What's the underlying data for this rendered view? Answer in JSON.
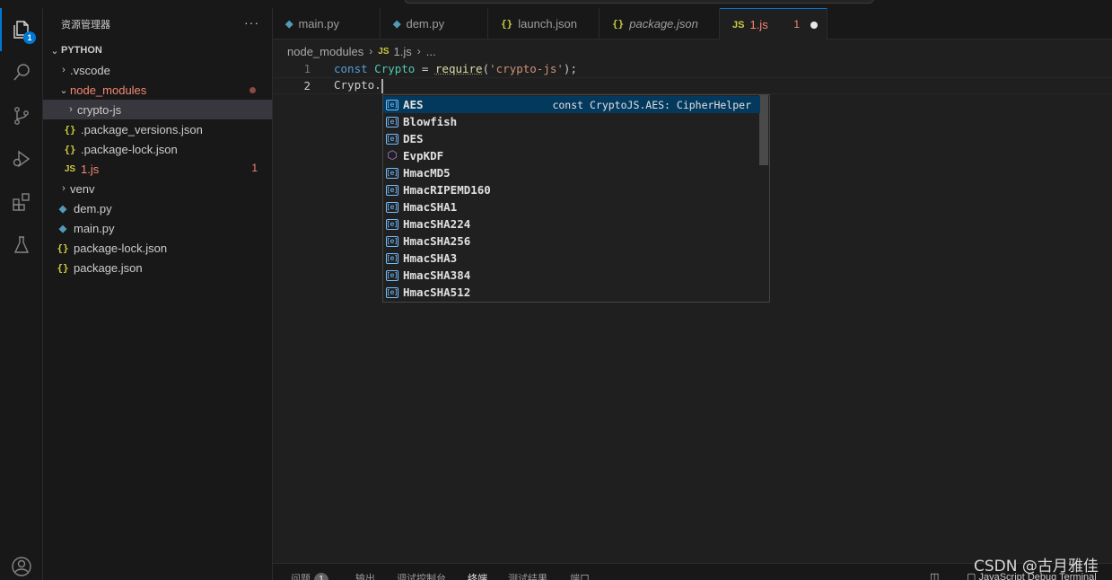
{
  "sidebar": {
    "title": "资源管理器",
    "more": "···",
    "explorer_badge": "1",
    "root": "PYTHON",
    "items": [
      {
        "label": ".vscode",
        "kind": "folder",
        "expanded": false
      },
      {
        "label": "node_modules",
        "kind": "folder",
        "expanded": true,
        "modified": true
      },
      {
        "label": "crypto-js",
        "kind": "folder",
        "expanded": false,
        "selected": true
      },
      {
        "label": ".package_versions.json",
        "kind": "json"
      },
      {
        "label": ".package-lock.json",
        "kind": "json"
      },
      {
        "label": "1.js",
        "kind": "js",
        "problems": "1"
      },
      {
        "label": "venv",
        "kind": "folder",
        "expanded": false
      },
      {
        "label": "dem.py",
        "kind": "py"
      },
      {
        "label": "main.py",
        "kind": "py"
      },
      {
        "label": "package-lock.json",
        "kind": "json"
      },
      {
        "label": "package.json",
        "kind": "json"
      }
    ]
  },
  "tabs": [
    {
      "label": "main.py",
      "icon": "python-icon"
    },
    {
      "label": "dem.py",
      "icon": "python-icon"
    },
    {
      "label": "launch.json",
      "icon": "json-icon"
    },
    {
      "label": "package.json",
      "icon": "json-icon"
    },
    {
      "label": "1.js",
      "icon": "js-icon",
      "problems": "1",
      "active": true,
      "dirty": true
    }
  ],
  "breadcrumb": {
    "folder": "node_modules",
    "file": "1.js",
    "more": "..."
  },
  "code": {
    "line1_no": "1",
    "line2_no": "2",
    "l1_const": "const",
    "l1_var": "Crypto",
    "l1_eq": " = ",
    "l1_fn": "require",
    "l1_open": "(",
    "l1_str": "'crypto-js'",
    "l1_close": ");",
    "l2_text": "Crypto."
  },
  "suggest": {
    "detail": "const CryptoJS.AES: CipherHelper",
    "items": [
      {
        "label": "AES",
        "icon": "field-icon",
        "selected": true
      },
      {
        "label": "Blowfish",
        "icon": "field-icon"
      },
      {
        "label": "DES",
        "icon": "field-icon"
      },
      {
        "label": "EvpKDF",
        "icon": "module-icon"
      },
      {
        "label": "HmacMD5",
        "icon": "field-icon"
      },
      {
        "label": "HmacRIPEMD160",
        "icon": "field-icon"
      },
      {
        "label": "HmacSHA1",
        "icon": "field-icon"
      },
      {
        "label": "HmacSHA224",
        "icon": "field-icon"
      },
      {
        "label": "HmacSHA256",
        "icon": "field-icon"
      },
      {
        "label": "HmacSHA3",
        "icon": "field-icon"
      },
      {
        "label": "HmacSHA384",
        "icon": "field-icon"
      },
      {
        "label": "HmacSHA512",
        "icon": "field-icon"
      }
    ]
  },
  "panel": {
    "problems": "问题",
    "problems_count": "1",
    "output": "输出",
    "debug_console": "调试控制台",
    "terminal": "终端",
    "test_results": "测试结果",
    "ports": "端口",
    "terminal_name": "JavaScript Debug Terminal"
  },
  "watermark": "CSDN @古月雅佳",
  "colors": {
    "accent": "#0078d4",
    "error": "#f48771",
    "selection": "#04395e"
  }
}
